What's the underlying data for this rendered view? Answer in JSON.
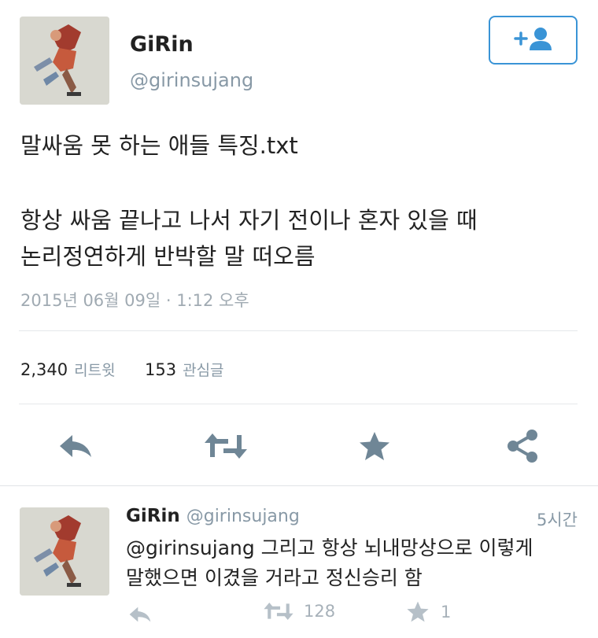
{
  "tweet": {
    "author_name": "GiRin",
    "author_handle": "@girinsujang",
    "text_line1": "말싸움 못 하는 애들 특징.txt",
    "text_line2": "항상 싸움 끝나고 나서 자기 전이나 혼자 있을 때",
    "text_line3": "논리정연하게 반박할 말 떠오름",
    "date": "2015년 06월 09일 · 1:12 오후",
    "retweets_count": "2,340",
    "retweets_label": "리트윗",
    "likes_count": "153",
    "likes_label": "관심글"
  },
  "reply": {
    "author_name": "GiRin",
    "author_handle": "@girinsujang",
    "time": "5시간",
    "mention": "@girinsujang",
    "text_line1_rest": " 그리고 항상 뇌내망상으로 이렇게",
    "text_line2": "말했으면 이겼을 거라고 정신승리 함",
    "retweets_count": "128",
    "likes_count": "1"
  },
  "icons": {
    "follow": "add-user-icon",
    "reply": "reply-icon",
    "retweet": "retweet-icon",
    "like": "star-icon",
    "share": "share-icon"
  },
  "colors": {
    "accent": "#3a94d6",
    "action_icon": "#6f8696",
    "secondary_text": "#8899a6"
  }
}
